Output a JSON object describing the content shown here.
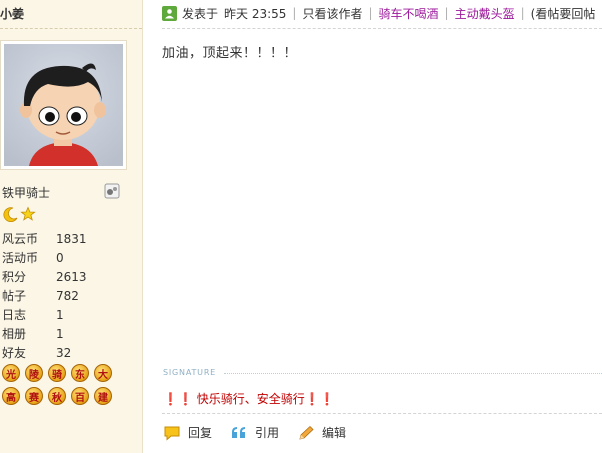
{
  "author": {
    "username": "小姜",
    "rank_title": "铁甲骑士",
    "stats": [
      {
        "label": "风云币",
        "value": "1831"
      },
      {
        "label": "活动币",
        "value": "0"
      },
      {
        "label": "积分",
        "value": "2613"
      },
      {
        "label": "帖子",
        "value": "782"
      },
      {
        "label": "日志",
        "value": "1"
      },
      {
        "label": "相册",
        "value": "1"
      },
      {
        "label": "好友",
        "value": "32"
      }
    ],
    "medals": [
      "光",
      "陵",
      "骑",
      "东",
      "大",
      "高",
      "赛",
      "秋",
      "百",
      "建"
    ]
  },
  "post": {
    "posted_label": "发表于",
    "posted_time": "昨天 23:55",
    "only_author": "只看该作者",
    "tag1": "骑车不喝酒",
    "tag2": "主动戴头盔",
    "hint": "(看帖要回帖",
    "content": "加油，顶起来！！！！"
  },
  "signature": {
    "label": "SIGNATURE",
    "text": "❗❗ 快乐骑行、安全骑行❗❗"
  },
  "actions": {
    "reply": "回复",
    "quote": "引用",
    "edit": "编辑"
  },
  "colors": {
    "sidebar_bg": "#fbf6e6",
    "tag_purple": "#9c1a9c",
    "signature_red": "#c00000"
  }
}
